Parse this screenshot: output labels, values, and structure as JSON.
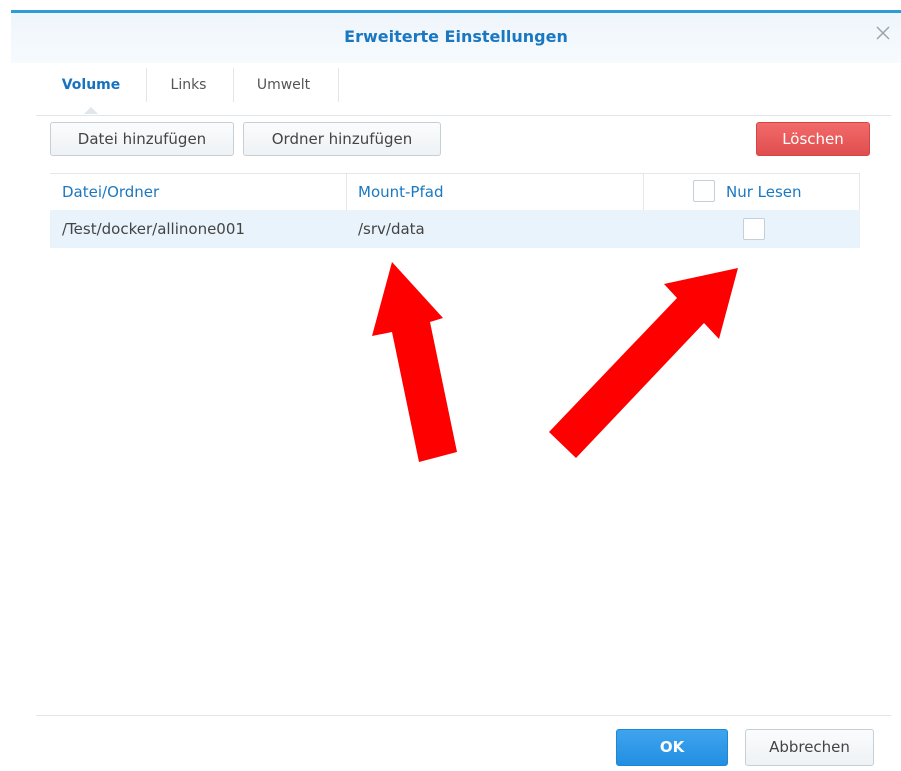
{
  "dialog": {
    "title": "Erweiterte Einstellungen",
    "close_icon": "close-icon"
  },
  "tabs": [
    {
      "label": "Volume",
      "active": true
    },
    {
      "label": "Links",
      "active": false
    },
    {
      "label": "Umwelt",
      "active": false
    }
  ],
  "toolbar": {
    "add_file": "Datei hinzufügen",
    "add_folder": "Ordner hinzufügen",
    "delete": "Löschen"
  },
  "table": {
    "columns": [
      "Datei/Ordner",
      "Mount-Pfad",
      "Nur Lesen"
    ],
    "rows": [
      {
        "file_folder": "/Test/docker/allinone001",
        "mount_path": "/srv/data",
        "read_only": false
      }
    ]
  },
  "footer": {
    "ok": "OK",
    "cancel": "Abbrechen"
  },
  "colors": {
    "accent": "#1a78c2",
    "danger": "#e04e4e",
    "primary": "#238fe1",
    "annotation_arrow": "#ff0000"
  }
}
